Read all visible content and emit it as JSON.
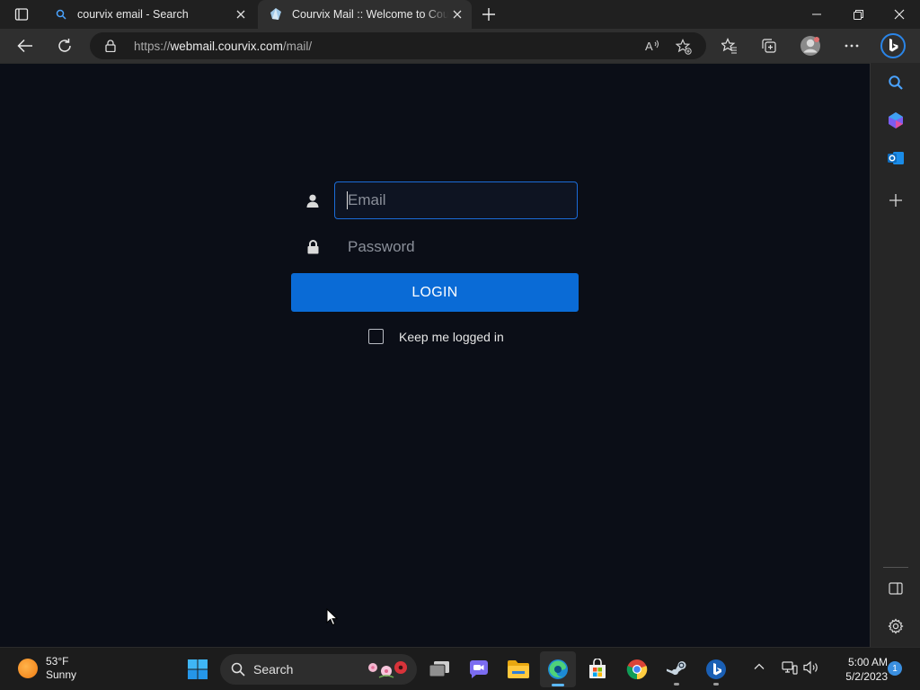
{
  "browser": {
    "tabs": [
      {
        "title": "courvix email - Search",
        "active": false,
        "icon": "search-icon"
      },
      {
        "title": "Courvix Mail :: Welcome to Courvix Mail",
        "active": true,
        "icon": "courvix-favicon"
      }
    ],
    "address": {
      "scheme": "https://",
      "host": "webmail.courvix.com",
      "path": "/mail/"
    }
  },
  "login": {
    "email_placeholder": "Email",
    "password_placeholder": "Password",
    "button_label": "LOGIN",
    "remember_label": "Keep me logged in",
    "remember_checked": false
  },
  "taskbar": {
    "weather": {
      "temp": "53°F",
      "condition": "Sunny"
    },
    "search_label": "Search",
    "clock": {
      "time": "5:00 AM",
      "date": "5/2/2023"
    },
    "notification_count": "1"
  },
  "colors": {
    "page_background": "#0b0e17",
    "accent": "#0a6bd6",
    "focus_border": "#1b6cd8"
  }
}
